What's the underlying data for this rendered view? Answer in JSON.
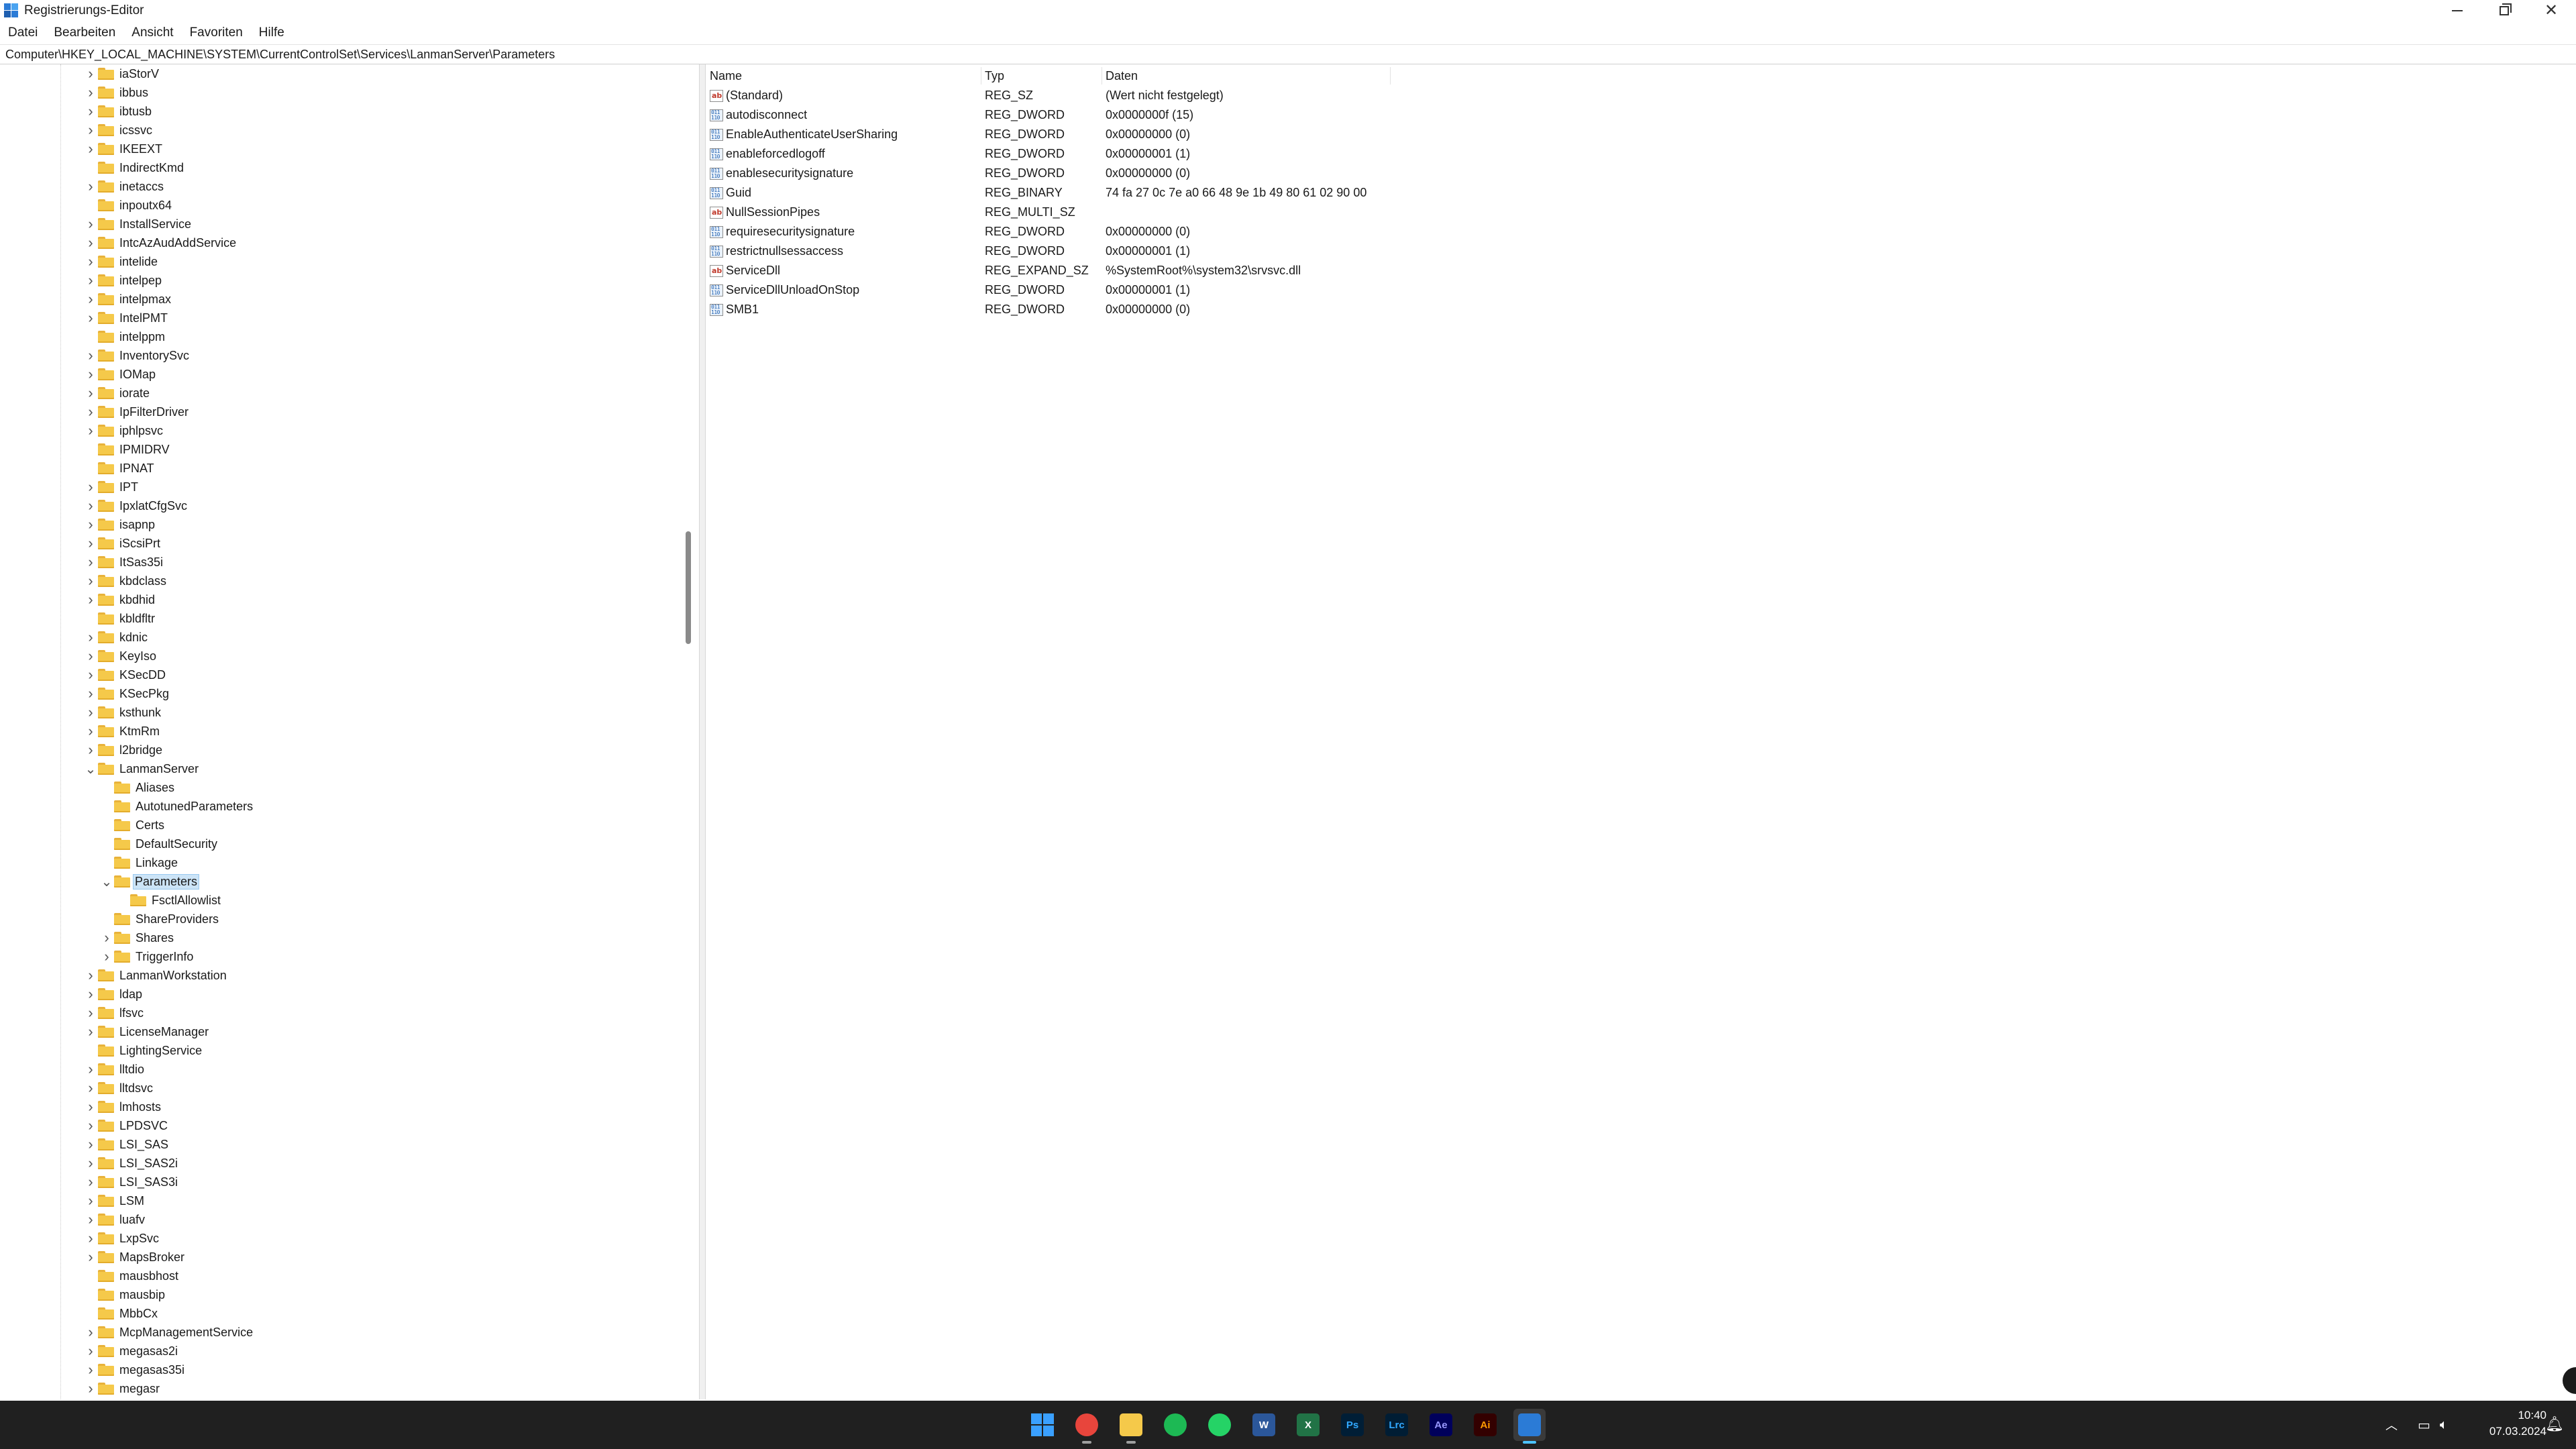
{
  "window": {
    "title": "Registrierungs-Editor",
    "controls": {
      "minimize": "—",
      "maximize": "□",
      "close": "✕"
    }
  },
  "menu": [
    "Datei",
    "Bearbeiten",
    "Ansicht",
    "Favoriten",
    "Hilfe"
  ],
  "address": "Computer\\HKEY_LOCAL_MACHINE\\SYSTEM\\CurrentControlSet\\Services\\LanmanServer\\Parameters",
  "tree": [
    {
      "label": "iaStorV",
      "level": 0,
      "expander": "collapsed"
    },
    {
      "label": "ibbus",
      "level": 0,
      "expander": "collapsed"
    },
    {
      "label": "ibtusb",
      "level": 0,
      "expander": "collapsed"
    },
    {
      "label": "icssvc",
      "level": 0,
      "expander": "collapsed"
    },
    {
      "label": "IKEEXT",
      "level": 0,
      "expander": "collapsed"
    },
    {
      "label": "IndirectKmd",
      "level": 0,
      "expander": "none"
    },
    {
      "label": "inetaccs",
      "level": 0,
      "expander": "collapsed"
    },
    {
      "label": "inpoutx64",
      "level": 0,
      "expander": "none"
    },
    {
      "label": "InstallService",
      "level": 0,
      "expander": "collapsed"
    },
    {
      "label": "IntcAzAudAddService",
      "level": 0,
      "expander": "collapsed"
    },
    {
      "label": "intelide",
      "level": 0,
      "expander": "collapsed"
    },
    {
      "label": "intelpep",
      "level": 0,
      "expander": "collapsed"
    },
    {
      "label": "intelpmax",
      "level": 0,
      "expander": "collapsed"
    },
    {
      "label": "IntelPMT",
      "level": 0,
      "expander": "collapsed"
    },
    {
      "label": "intelppm",
      "level": 0,
      "expander": "none"
    },
    {
      "label": "InventorySvc",
      "level": 0,
      "expander": "collapsed"
    },
    {
      "label": "IOMap",
      "level": 0,
      "expander": "collapsed"
    },
    {
      "label": "iorate",
      "level": 0,
      "expander": "collapsed"
    },
    {
      "label": "IpFilterDriver",
      "level": 0,
      "expander": "collapsed"
    },
    {
      "label": "iphlpsvc",
      "level": 0,
      "expander": "collapsed"
    },
    {
      "label": "IPMIDRV",
      "level": 0,
      "expander": "none"
    },
    {
      "label": "IPNAT",
      "level": 0,
      "expander": "none"
    },
    {
      "label": "IPT",
      "level": 0,
      "expander": "collapsed"
    },
    {
      "label": "IpxlatCfgSvc",
      "level": 0,
      "expander": "collapsed"
    },
    {
      "label": "isapnp",
      "level": 0,
      "expander": "collapsed"
    },
    {
      "label": "iScsiPrt",
      "level": 0,
      "expander": "collapsed"
    },
    {
      "label": "ItSas35i",
      "level": 0,
      "expander": "collapsed"
    },
    {
      "label": "kbdclass",
      "level": 0,
      "expander": "collapsed"
    },
    {
      "label": "kbdhid",
      "level": 0,
      "expander": "collapsed"
    },
    {
      "label": "kbldfltr",
      "level": 0,
      "expander": "none"
    },
    {
      "label": "kdnic",
      "level": 0,
      "expander": "collapsed"
    },
    {
      "label": "KeyIso",
      "level": 0,
      "expander": "collapsed"
    },
    {
      "label": "KSecDD",
      "level": 0,
      "expander": "collapsed"
    },
    {
      "label": "KSecPkg",
      "level": 0,
      "expander": "collapsed"
    },
    {
      "label": "ksthunk",
      "level": 0,
      "expander": "collapsed"
    },
    {
      "label": "KtmRm",
      "level": 0,
      "expander": "collapsed"
    },
    {
      "label": "l2bridge",
      "level": 0,
      "expander": "collapsed"
    },
    {
      "label": "LanmanServer",
      "level": 0,
      "expander": "expanded"
    },
    {
      "label": "Aliases",
      "level": 1,
      "expander": "none"
    },
    {
      "label": "AutotunedParameters",
      "level": 1,
      "expander": "none"
    },
    {
      "label": "Certs",
      "level": 1,
      "expander": "none"
    },
    {
      "label": "DefaultSecurity",
      "level": 1,
      "expander": "none"
    },
    {
      "label": "Linkage",
      "level": 1,
      "expander": "none"
    },
    {
      "label": "Parameters",
      "level": 1,
      "expander": "expanded",
      "selected": true
    },
    {
      "label": "FsctlAllowlist",
      "level": 2,
      "expander": "none"
    },
    {
      "label": "ShareProviders",
      "level": 1,
      "expander": "none"
    },
    {
      "label": "Shares",
      "level": 1,
      "expander": "collapsed"
    },
    {
      "label": "TriggerInfo",
      "level": 1,
      "expander": "collapsed"
    },
    {
      "label": "LanmanWorkstation",
      "level": 0,
      "expander": "collapsed"
    },
    {
      "label": "ldap",
      "level": 0,
      "expander": "collapsed"
    },
    {
      "label": "lfsvc",
      "level": 0,
      "expander": "collapsed"
    },
    {
      "label": "LicenseManager",
      "level": 0,
      "expander": "collapsed"
    },
    {
      "label": "LightingService",
      "level": 0,
      "expander": "none"
    },
    {
      "label": "lltdio",
      "level": 0,
      "expander": "collapsed"
    },
    {
      "label": "lltdsvc",
      "level": 0,
      "expander": "collapsed"
    },
    {
      "label": "lmhosts",
      "level": 0,
      "expander": "collapsed"
    },
    {
      "label": "LPDSVC",
      "level": 0,
      "expander": "collapsed"
    },
    {
      "label": "LSI_SAS",
      "level": 0,
      "expander": "collapsed"
    },
    {
      "label": "LSI_SAS2i",
      "level": 0,
      "expander": "collapsed"
    },
    {
      "label": "LSI_SAS3i",
      "level": 0,
      "expander": "collapsed"
    },
    {
      "label": "LSM",
      "level": 0,
      "expander": "collapsed"
    },
    {
      "label": "luafv",
      "level": 0,
      "expander": "collapsed"
    },
    {
      "label": "LxpSvc",
      "level": 0,
      "expander": "collapsed"
    },
    {
      "label": "MapsBroker",
      "level": 0,
      "expander": "collapsed"
    },
    {
      "label": "mausbhost",
      "level": 0,
      "expander": "none"
    },
    {
      "label": "mausbip",
      "level": 0,
      "expander": "none"
    },
    {
      "label": "MbbCx",
      "level": 0,
      "expander": "none"
    },
    {
      "label": "McpManagementService",
      "level": 0,
      "expander": "collapsed"
    },
    {
      "label": "megasas2i",
      "level": 0,
      "expander": "collapsed"
    },
    {
      "label": "megasas35i",
      "level": 0,
      "expander": "collapsed"
    },
    {
      "label": "megasr",
      "level": 0,
      "expander": "collapsed"
    }
  ],
  "values": {
    "columns": {
      "name": "Name",
      "type": "Typ",
      "data": "Daten"
    },
    "rows": [
      {
        "name": "(Standard)",
        "type": "REG_SZ",
        "data": "(Wert nicht festgelegt)",
        "icon": "string"
      },
      {
        "name": "autodisconnect",
        "type": "REG_DWORD",
        "data": "0x0000000f (15)",
        "icon": "binary"
      },
      {
        "name": "EnableAuthenticateUserSharing",
        "type": "REG_DWORD",
        "data": "0x00000000 (0)",
        "icon": "binary"
      },
      {
        "name": "enableforcedlogoff",
        "type": "REG_DWORD",
        "data": "0x00000001 (1)",
        "icon": "binary"
      },
      {
        "name": "enablesecuritysignature",
        "type": "REG_DWORD",
        "data": "0x00000000 (0)",
        "icon": "binary"
      },
      {
        "name": "Guid",
        "type": "REG_BINARY",
        "data": "74 fa 27 0c 7e a0 66 48 9e 1b 49 80 61 02 90 00",
        "icon": "binary"
      },
      {
        "name": "NullSessionPipes",
        "type": "REG_MULTI_SZ",
        "data": "",
        "icon": "string"
      },
      {
        "name": "requiresecuritysignature",
        "type": "REG_DWORD",
        "data": "0x00000000 (0)",
        "icon": "binary"
      },
      {
        "name": "restrictnullsessaccess",
        "type": "REG_DWORD",
        "data": "0x00000001 (1)",
        "icon": "binary"
      },
      {
        "name": "ServiceDll",
        "type": "REG_EXPAND_SZ",
        "data": "%SystemRoot%\\system32\\srvsvc.dll",
        "icon": "string"
      },
      {
        "name": "ServiceDllUnloadOnStop",
        "type": "REG_DWORD",
        "data": "0x00000001 (1)",
        "icon": "binary"
      },
      {
        "name": "SMB1",
        "type": "REG_DWORD",
        "data": "0x00000000 (0)",
        "icon": "binary"
      }
    ]
  },
  "taskbar": {
    "apps": [
      {
        "name": "start-button",
        "icon": "windows-logo-icon",
        "label": ""
      },
      {
        "name": "chrome",
        "icon": "chrome-icon",
        "label": ""
      },
      {
        "name": "file-explorer",
        "icon": "folder-icon",
        "label": ""
      },
      {
        "name": "spotify",
        "icon": "spotify-icon",
        "label": ""
      },
      {
        "name": "whatsapp",
        "icon": "whatsapp-icon",
        "label": ""
      },
      {
        "name": "word",
        "icon": "word-icon",
        "label": "W"
      },
      {
        "name": "excel",
        "icon": "excel-icon",
        "label": "X"
      },
      {
        "name": "photoshop",
        "icon": "photoshop-icon",
        "label": "Ps"
      },
      {
        "name": "lightroom-classic",
        "icon": "lightroom-icon",
        "label": "Lrc"
      },
      {
        "name": "after-effects",
        "icon": "after-effects-icon",
        "label": "Ae"
      },
      {
        "name": "illustrator",
        "icon": "illustrator-icon",
        "label": "Ai"
      },
      {
        "name": "registry-editor",
        "icon": "registry-editor-icon",
        "label": ""
      }
    ],
    "time": "10:40",
    "date": "07.03.2024"
  },
  "colors": {
    "selection": "#cce4f7",
    "taskbar": "#202020",
    "folder": "#f5c94a",
    "accent": "#4cc2ff"
  }
}
